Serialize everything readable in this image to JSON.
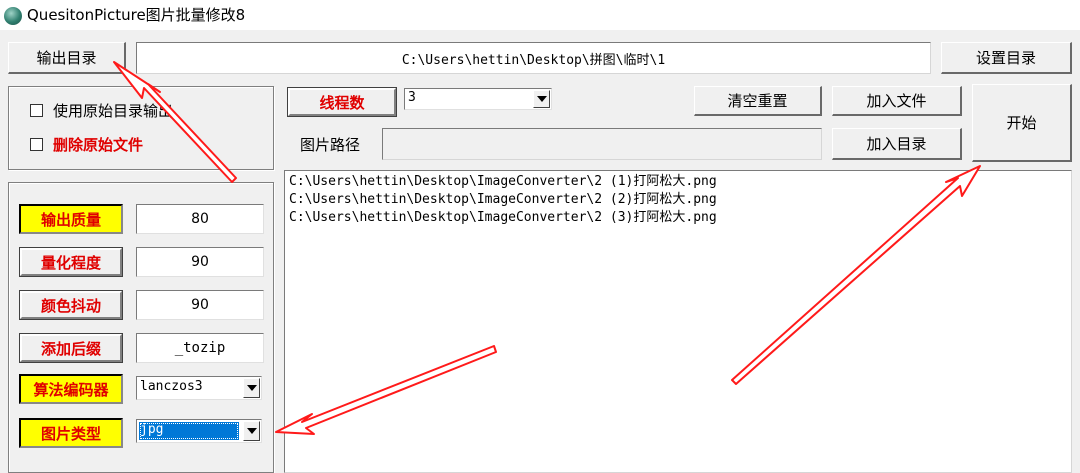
{
  "window": {
    "title": "QuesitonPicture图片批量修改8"
  },
  "output": {
    "dir_button": "输出目录",
    "path": "C:\\Users\\hettin\\Desktop\\拼图\\临时\\1",
    "set_dir_button": "设置目录"
  },
  "options": {
    "use_original_dir": "使用原始目录输出",
    "delete_original": "删除原始文件"
  },
  "threads": {
    "label": "线程数",
    "value": "3"
  },
  "actions": {
    "clear_reset": "清空重置",
    "add_files": "加入文件",
    "add_dir": "加入目录",
    "start": "开始"
  },
  "image_path": {
    "label": "图片路径",
    "value": ""
  },
  "settings": {
    "quality": {
      "label": "输出质量",
      "value": "80"
    },
    "quantize": {
      "label": "量化程度",
      "value": "90"
    },
    "dither": {
      "label": "颜色抖动",
      "value": "90"
    },
    "suffix": {
      "label": "添加后缀",
      "value": "_tozip"
    },
    "algorithm": {
      "label": "算法编码器",
      "value": "lanczos3"
    },
    "image_type": {
      "label": "图片类型",
      "value": "jpg"
    }
  },
  "files": [
    "C:\\Users\\hettin\\Desktop\\ImageConverter\\2 (1)打阿松大.png",
    "C:\\Users\\hettin\\Desktop\\ImageConverter\\2 (2)打阿松大.png",
    "C:\\Users\\hettin\\Desktop\\ImageConverter\\2 (3)打阿松大.png"
  ],
  "colors": {
    "label_yellow": "#ffff00",
    "label_text_red": "#e00000",
    "arrow_red": "#ff1a1a",
    "selection_blue": "#0078d7"
  }
}
